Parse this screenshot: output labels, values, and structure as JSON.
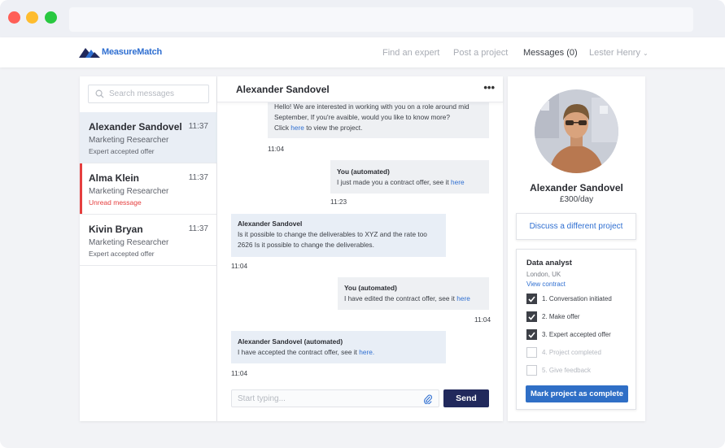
{
  "brand": {
    "name": "MeasureMatch",
    "accent": "#2f6fd1",
    "dark": "#21295c",
    "unread": "#e53e3e"
  },
  "nav": {
    "find_expert": "Find an expert",
    "post_project": "Post a project",
    "messages": "Messages (0)",
    "user": "Lester Henry"
  },
  "search": {
    "placeholder": "Search messages"
  },
  "conversations": [
    {
      "name": "Alexander Sandovel",
      "time": "11:37",
      "role": "Marketing Researcher",
      "status": "Expert accepted offer"
    },
    {
      "name": "Alma Klein",
      "time": "11:37",
      "role": "Marketing Researcher",
      "status": "Unread message"
    },
    {
      "name": "Kivin Bryan",
      "time": "11:37",
      "role": "Marketing Researcher",
      "status": "Expert accepted offer"
    }
  ],
  "chat": {
    "title": "Alexander Sandovel",
    "more_icon": "more-horizontal-icon",
    "messages": [
      {
        "line1": "Hello! We are interested in working with you on a role around mid",
        "line2": "September, If you're avaible, would you like to know more?",
        "pre": "Click ",
        "link": "here",
        "post": " to view the project.",
        "time": "11:04"
      },
      {
        "sender": "You (automated)",
        "pre": "I just made you a contract offer, see it ",
        "link": "here",
        "time": "11:23"
      },
      {
        "sender": "Alexander Sandovel",
        "line1": "Is it possible to change the deliverables to XYZ and the rate too",
        "line2": "2626 Is it possible to change the deliverables.",
        "time": "11:04"
      },
      {
        "sender": "You (automated)",
        "pre": "I have edited the contract offer, see it ",
        "link": "here",
        "time": "11:04"
      },
      {
        "sender": "Alexander Sandovel (automated)",
        "pre": "I have accepted the contract offer, see it ",
        "link": "here.",
        "time": "11:04"
      }
    ],
    "composer_placeholder": "Start typing...",
    "send": "Send"
  },
  "profile": {
    "name": "Alexander Sandovel",
    "rate": "£300/day",
    "discuss": "Discuss a different project"
  },
  "project": {
    "title": "Data analyst",
    "location": "London, UK",
    "view_contract": "View contract",
    "steps": [
      {
        "label": "1. Conversation initiated",
        "checked": true
      },
      {
        "label": "2. Make offer",
        "checked": true
      },
      {
        "label": "3. Expert accepted offer",
        "checked": true
      },
      {
        "label": "4. Project completed",
        "checked": false
      },
      {
        "label": "5. Give feedback",
        "checked": false
      }
    ],
    "complete_button": "Mark project as complete"
  }
}
